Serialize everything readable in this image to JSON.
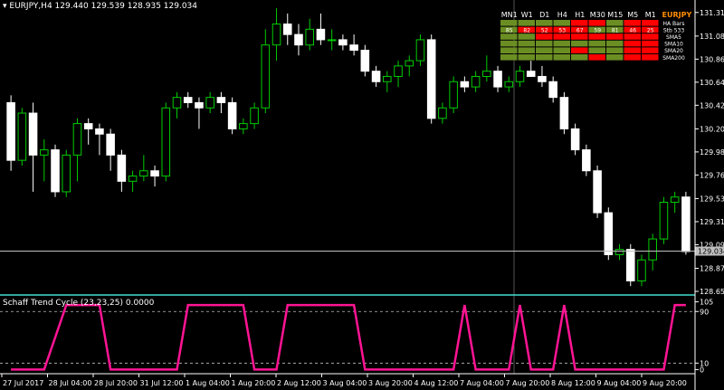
{
  "header": {
    "symbol_tf": "EURJPY,H4",
    "ohlc": "129.440 129.539 128.935 129.034"
  },
  "indicator": {
    "title": "Schaff Trend Cycle (23,23,25) 0.0000",
    "levels": [
      "105",
      "90",
      "10",
      "0"
    ]
  },
  "colors": {
    "background": "#000000",
    "bull_candle": "#00cc00",
    "bear_candle": "#ffffff",
    "stc_line": "#ff1493",
    "grid_line": "#c0c0c0",
    "separator": "#40e0d0",
    "table_green": "#6b8e23",
    "table_red": "#ff0000",
    "pair_label": "#ff8c00"
  },
  "price_axis": {
    "ticks": [
      "131.310",
      "131.085",
      "130.865",
      "130.645",
      "130.425",
      "130.200",
      "129.980",
      "129.760",
      "129.535",
      "129.315",
      "129.095",
      "128.870",
      "128.650"
    ],
    "current": "129.034"
  },
  "time_axis": {
    "ticks": [
      "27 Jul 2017",
      "28 Jul 04:00",
      "28 Jul 20:00",
      "31 Jul 12:00",
      "1 Aug 04:00",
      "1 Aug 20:00",
      "2 Aug 12:00",
      "3 Aug 04:00",
      "3 Aug 20:00",
      "4 Aug 12:00",
      "7 Aug 04:00",
      "7 Aug 20:00",
      "8 Aug 12:00",
      "9 Aug 04:00",
      "9 Aug 20:00"
    ]
  },
  "dashboard": {
    "pair": "EURJPY",
    "timeframes": [
      "MN1",
      "W1",
      "D1",
      "H4",
      "H1",
      "M30",
      "M15",
      "M5",
      "M1"
    ],
    "rows": [
      {
        "label": "HA Bars",
        "cells": [
          "g",
          "g",
          "g",
          "g",
          "r",
          "r",
          "g",
          "r",
          "r"
        ],
        "values": [
          "",
          "",
          "",
          "",
          "",
          "",
          "",
          "",
          ""
        ]
      },
      {
        "label": "Stb 533",
        "cells": [
          "g",
          "r",
          "r",
          "r",
          "r",
          "g",
          "g",
          "r",
          "r"
        ],
        "values": [
          "85",
          "82",
          "52",
          "53",
          "67",
          "59",
          "81",
          "46",
          "25"
        ]
      },
      {
        "label": "SMA5",
        "cells": [
          "g",
          "g",
          "r",
          "r",
          "r",
          "r",
          "r",
          "r",
          "r"
        ],
        "values": [
          "",
          "",
          "",
          "",
          "",
          "",
          "",
          "",
          ""
        ]
      },
      {
        "label": "SMA10",
        "cells": [
          "g",
          "g",
          "g",
          "g",
          "g",
          "g",
          "g",
          "r",
          "r"
        ],
        "values": [
          "",
          "",
          "",
          "",
          "",
          "",
          "",
          "",
          ""
        ]
      },
      {
        "label": "SMA20",
        "cells": [
          "g",
          "g",
          "g",
          "g",
          "r",
          "g",
          "g",
          "r",
          "r"
        ],
        "values": [
          "",
          "",
          "",
          "",
          "",
          "",
          "",
          "",
          ""
        ]
      },
      {
        "label": "SMA200",
        "cells": [
          "g",
          "g",
          "g",
          "g",
          "g",
          "r",
          "g",
          "r",
          "r"
        ],
        "values": [
          "",
          "",
          "",
          "",
          "",
          "",
          "",
          "",
          ""
        ]
      }
    ]
  },
  "chart_data": [
    {
      "type": "candlestick",
      "title": "EURJPY,H4",
      "ylim": [
        128.65,
        131.36
      ],
      "candles": [
        [
          130.45,
          130.52,
          129.8,
          129.9
        ],
        [
          129.9,
          130.4,
          129.85,
          130.35
        ],
        [
          130.35,
          130.45,
          129.6,
          129.95
        ],
        [
          129.95,
          130.1,
          129.7,
          130.0
        ],
        [
          130.0,
          130.05,
          129.55,
          129.6
        ],
        [
          129.6,
          130.0,
          129.55,
          129.95
        ],
        [
          129.95,
          130.3,
          129.7,
          130.25
        ],
        [
          130.25,
          130.3,
          130.05,
          130.2
        ],
        [
          130.2,
          130.25,
          129.95,
          130.15
        ],
        [
          130.15,
          130.2,
          129.8,
          129.95
        ],
        [
          129.95,
          130.0,
          129.6,
          129.7
        ],
        [
          129.7,
          129.8,
          129.6,
          129.75
        ],
        [
          129.75,
          129.95,
          129.7,
          129.8
        ],
        [
          129.8,
          129.85,
          129.65,
          129.75
        ],
        [
          129.75,
          130.45,
          129.7,
          130.4
        ],
        [
          130.4,
          130.55,
          130.3,
          130.5
        ],
        [
          130.5,
          130.55,
          130.4,
          130.45
        ],
        [
          130.45,
          130.5,
          130.2,
          130.4
        ],
        [
          130.4,
          130.55,
          130.35,
          130.5
        ],
        [
          130.5,
          130.55,
          130.35,
          130.45
        ],
        [
          130.45,
          130.5,
          130.15,
          130.2
        ],
        [
          130.2,
          130.3,
          130.15,
          130.25
        ],
        [
          130.25,
          130.45,
          130.2,
          130.4
        ],
        [
          130.4,
          131.15,
          130.35,
          131.0
        ],
        [
          131.0,
          131.35,
          130.85,
          131.2
        ],
        [
          131.2,
          131.3,
          131.0,
          131.1
        ],
        [
          131.1,
          131.2,
          130.9,
          131.0
        ],
        [
          131.0,
          131.25,
          130.95,
          131.15
        ],
        [
          131.15,
          131.3,
          131.0,
          131.05
        ],
        [
          131.05,
          131.15,
          130.95,
          131.05
        ],
        [
          131.05,
          131.1,
          130.95,
          131.0
        ],
        [
          131.0,
          131.1,
          130.9,
          130.95
        ],
        [
          130.95,
          131.0,
          130.7,
          130.75
        ],
        [
          130.75,
          130.8,
          130.6,
          130.65
        ],
        [
          130.65,
          130.75,
          130.55,
          130.7
        ],
        [
          130.7,
          130.85,
          130.6,
          130.8
        ],
        [
          130.8,
          130.9,
          130.7,
          130.85
        ],
        [
          130.85,
          131.1,
          130.8,
          131.05
        ],
        [
          131.05,
          131.1,
          130.25,
          130.3
        ],
        [
          130.3,
          130.45,
          130.25,
          130.4
        ],
        [
          130.4,
          130.7,
          130.35,
          130.65
        ],
        [
          130.65,
          130.7,
          130.55,
          130.6
        ],
        [
          130.6,
          130.75,
          130.55,
          130.7
        ],
        [
          130.7,
          130.9,
          130.65,
          130.75
        ],
        [
          130.75,
          130.8,
          130.55,
          130.6
        ],
        [
          130.6,
          130.7,
          130.55,
          130.65
        ],
        [
          130.65,
          130.8,
          130.6,
          130.75
        ],
        [
          130.75,
          130.85,
          130.7,
          130.7
        ],
        [
          130.7,
          130.8,
          130.6,
          130.65
        ],
        [
          130.65,
          130.7,
          130.45,
          130.5
        ],
        [
          130.5,
          130.55,
          130.15,
          130.2
        ],
        [
          130.2,
          130.25,
          129.95,
          130.0
        ],
        [
          130.0,
          130.05,
          129.75,
          129.8
        ],
        [
          129.8,
          129.85,
          129.35,
          129.4
        ],
        [
          129.4,
          129.45,
          128.95,
          129.0
        ],
        [
          129.0,
          129.1,
          128.95,
          129.05
        ],
        [
          129.05,
          129.1,
          128.7,
          128.75
        ],
        [
          128.75,
          129.0,
          128.7,
          128.95
        ],
        [
          128.95,
          129.2,
          128.85,
          129.15
        ],
        [
          129.15,
          129.55,
          129.1,
          129.5
        ],
        [
          129.5,
          129.6,
          129.4,
          129.55
        ],
        [
          129.55,
          129.6,
          129.0,
          129.03
        ]
      ]
    },
    {
      "type": "line",
      "title": "Schaff Trend Cycle (23,23,25) 0.0000",
      "ylim": [
        -5,
        110
      ],
      "series": [
        {
          "name": "Schaff Trend Cycle (23,23,25)",
          "x": [
            0,
            1,
            2,
            3,
            4,
            5,
            6,
            7,
            8,
            9,
            10,
            11,
            12,
            13,
            14,
            15,
            16,
            17,
            18,
            19,
            20,
            21,
            22,
            23,
            24,
            25,
            26,
            27,
            28,
            29,
            30,
            31,
            32,
            33,
            34,
            35,
            36,
            37,
            38,
            39,
            40,
            41,
            42,
            43,
            44,
            45,
            46,
            47,
            48,
            49,
            50,
            51,
            52,
            53,
            54,
            55,
            56,
            57,
            58,
            59,
            60,
            61
          ],
          "values": [
            0,
            0,
            0,
            0,
            50,
            100,
            100,
            100,
            100,
            0,
            0,
            0,
            0,
            0,
            0,
            0,
            100,
            100,
            100,
            100,
            100,
            100,
            0,
            0,
            0,
            100,
            100,
            100,
            100,
            100,
            100,
            100,
            0,
            0,
            0,
            0,
            0,
            0,
            0,
            0,
            0,
            100,
            0,
            0,
            0,
            0,
            100,
            0,
            0,
            0,
            100,
            0,
            0,
            0,
            0,
            0,
            0,
            0,
            0,
            0,
            100,
            100
          ]
        }
      ]
    }
  ]
}
